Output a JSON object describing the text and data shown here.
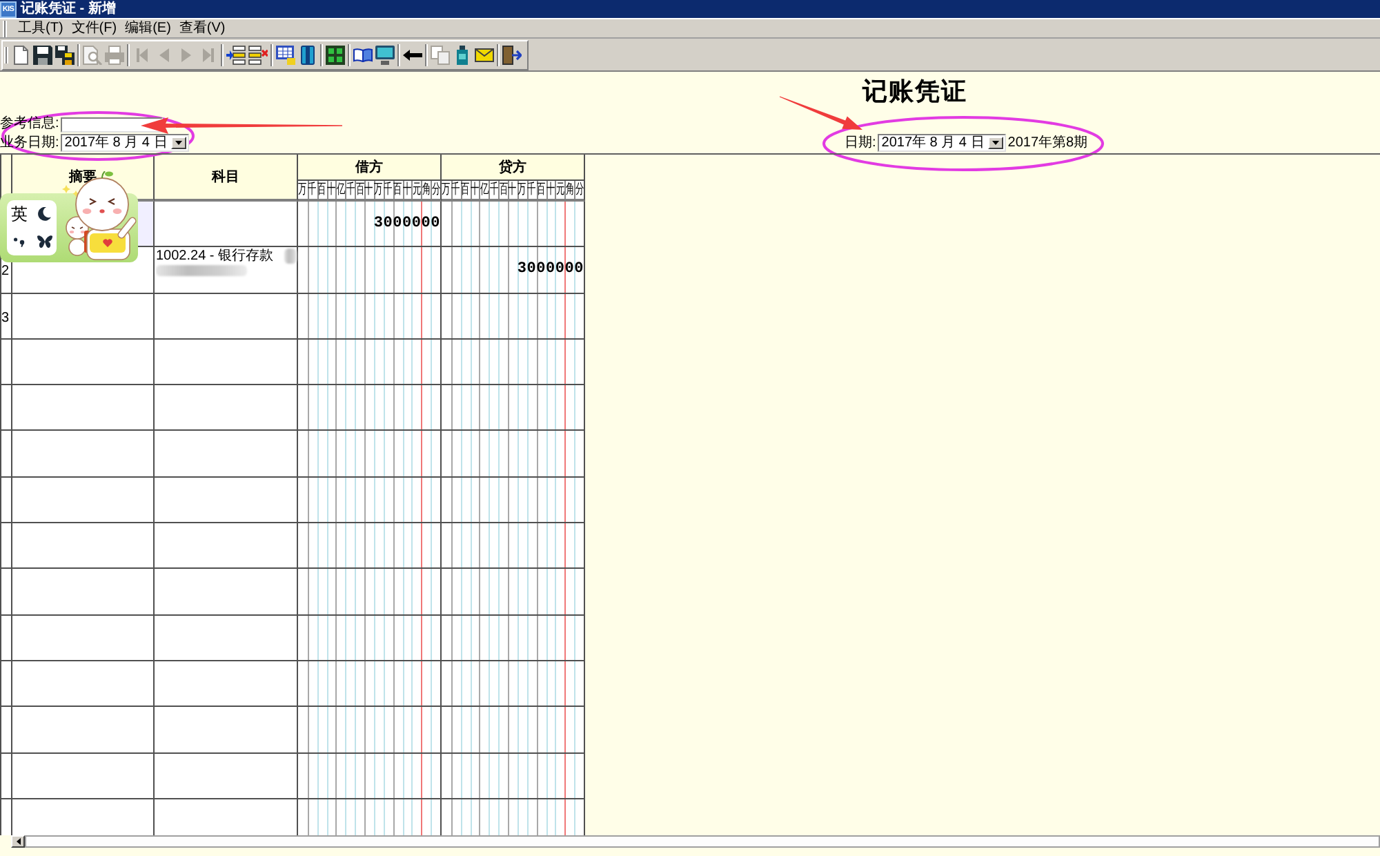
{
  "window": {
    "logo": "KIS",
    "title": "记账凭证 - 新增"
  },
  "menu": [
    {
      "label": "工具(T)"
    },
    {
      "label": "文件(F)"
    },
    {
      "label": "编辑(E)"
    },
    {
      "label": "查看(V)"
    }
  ],
  "toolbar": [
    {
      "buttons": [
        {
          "disabled": false
        },
        {
          "disabled": false
        },
        {
          "disabled": false
        }
      ]
    },
    {
      "buttons": [
        {
          "disabled": true
        },
        {
          "disabled": true
        }
      ]
    },
    {
      "buttons": [
        {
          "disabled": true
        },
        {
          "disabled": true
        },
        {
          "disabled": true
        },
        {
          "disabled": true
        }
      ]
    },
    {
      "buttons": [
        {
          "disabled": false
        },
        {
          "disabled": false
        }
      ]
    },
    {
      "buttons": [
        {
          "disabled": false
        },
        {
          "disabled": false
        }
      ]
    },
    {
      "buttons": [
        {
          "disabled": false
        }
      ]
    },
    {
      "buttons": [
        {
          "disabled": false
        },
        {
          "disabled": false
        }
      ]
    },
    {
      "buttons": [
        {
          "disabled": false
        }
      ]
    },
    {
      "buttons": [
        {
          "disabled": true
        },
        {
          "disabled": false
        },
        {
          "disabled": false
        }
      ]
    },
    {
      "buttons": [
        {
          "disabled": false
        }
      ]
    }
  ],
  "voucher": {
    "title": "记账凭证",
    "reference_label": "参考信息:",
    "business_date_label": "业务日期:",
    "business_date": "2017年 8 月 4 日",
    "date_label": "日期:",
    "date": "2017年 8 月 4 日",
    "period": "2017年第8期"
  },
  "table": {
    "columns": [
      {
        "kind": "text",
        "label": "摘要"
      },
      {
        "kind": "text",
        "label": "科目"
      },
      {
        "kind": "amount",
        "label": "借方",
        "units": [
          "万",
          "千",
          "百",
          "十",
          "亿",
          "千",
          "百",
          "十",
          "万",
          "千",
          "百",
          "十",
          "元",
          "角",
          "分"
        ]
      },
      {
        "kind": "amount",
        "label": "贷方",
        "units": [
          "万",
          "千",
          "百",
          "十",
          "亿",
          "千",
          "百",
          "十",
          "万",
          "千",
          "百",
          "十",
          "元",
          "角",
          "分"
        ]
      }
    ],
    "rows": [
      {
        "selected": true,
        "redacted": false,
        "debit": "3000000"
      },
      {
        "number": "2",
        "selected": false,
        "redacted": true,
        "account": "1002.24 - 银行存款",
        "credit": "3000000"
      },
      {
        "number": "3",
        "selected": false,
        "redacted": false
      },
      {
        "selected": false,
        "redacted": false
      },
      {
        "selected": false,
        "redacted": false
      },
      {
        "selected": false,
        "redacted": false
      },
      {
        "selected": false,
        "redacted": false
      },
      {
        "selected": false,
        "redacted": false
      },
      {
        "selected": false,
        "redacted": false
      },
      {
        "selected": false,
        "redacted": false
      },
      {
        "selected": false,
        "redacted": false
      },
      {
        "selected": false,
        "redacted": false
      },
      {
        "selected": false,
        "redacted": false
      },
      {
        "selected": false,
        "redacted": false
      }
    ]
  },
  "ime_toolbar": {
    "mode": "英"
  }
}
